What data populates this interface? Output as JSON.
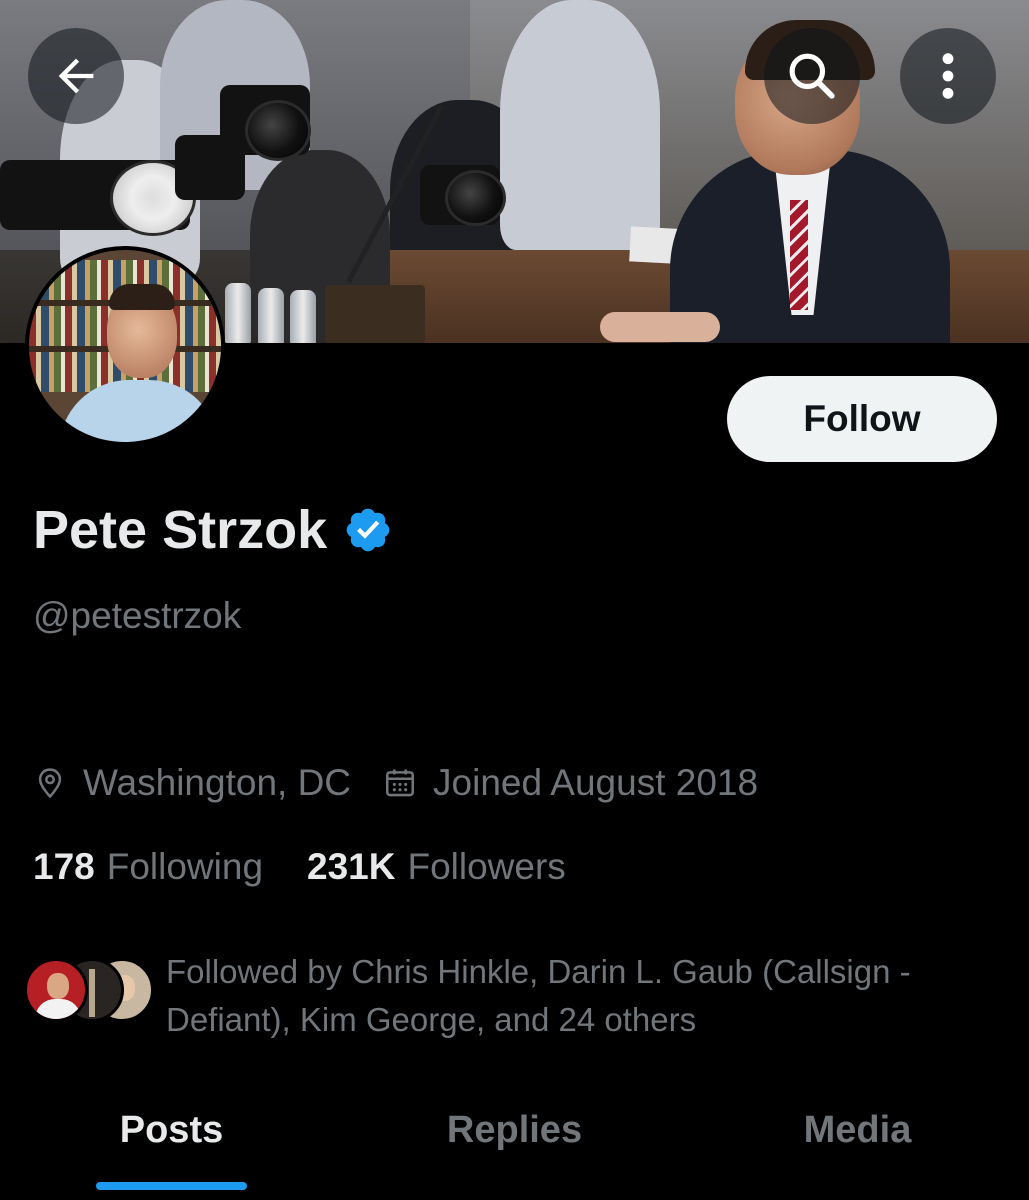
{
  "header": {
    "back_icon": "arrow-left-icon",
    "search_icon": "search-icon",
    "more_icon": "more-vertical-icon"
  },
  "profile": {
    "display_name": "Pete Strzok",
    "verified": true,
    "verified_color": "#1d9bf0",
    "handle": "@petestrzok",
    "follow_label": "Follow",
    "location": "Washington, DC",
    "joined": "Joined August 2018",
    "following_count": "178",
    "following_label": "Following",
    "followers_count": "231K",
    "followers_label": "Followers",
    "followed_by_text": "Followed by Chris Hinkle, Darin L. Gaub (Callsign - Defiant), Kim George, and 24 others"
  },
  "tabs": [
    {
      "label": "Posts",
      "active": true
    },
    {
      "label": "Replies",
      "active": false
    },
    {
      "label": "Media",
      "active": false
    }
  ],
  "colors": {
    "background": "#000000",
    "primary_text": "#e7e9ea",
    "secondary_text": "#71767b",
    "accent": "#1d9bf0"
  }
}
